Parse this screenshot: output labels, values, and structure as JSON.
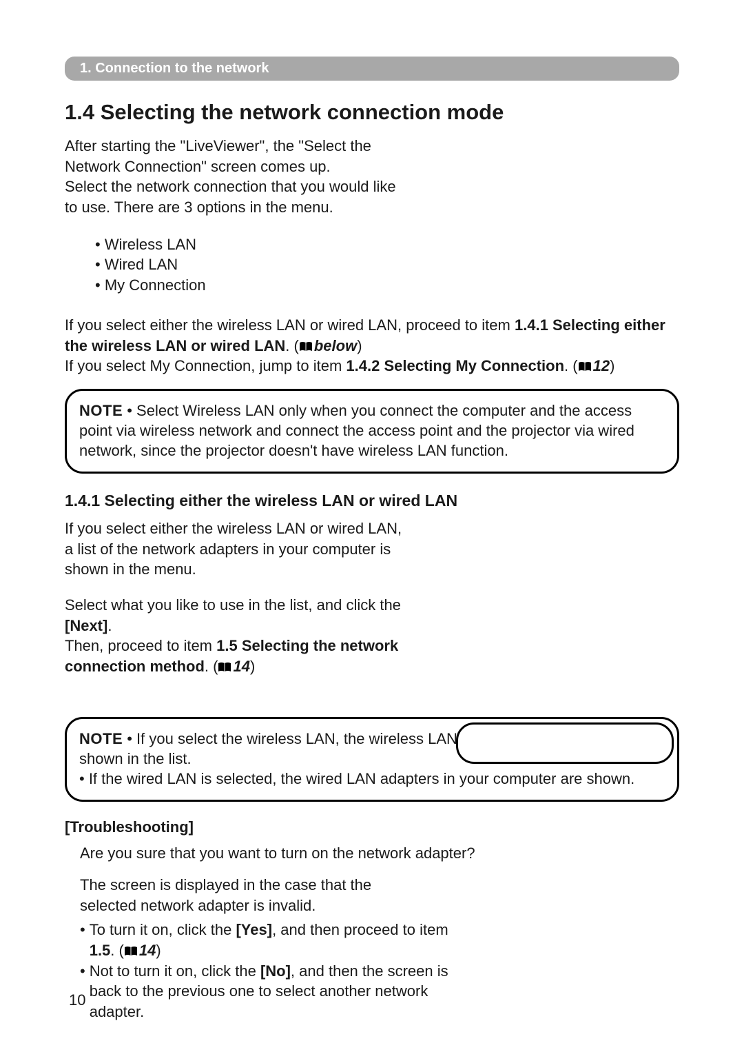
{
  "chapter_bar": "1. Connection to the network",
  "section_title": "1.4 Selecting the network connection mode",
  "intro_lines": [
    "After starting the \"LiveViewer\", the \"Select the",
    "Network Connection\" screen comes up.",
    "Select the network connection that you would like",
    "to use. There are 3 options in the menu."
  ],
  "options": [
    "Wireless LAN",
    "Wired LAN",
    "My Connection"
  ],
  "para1_pre": "If you select either the wireless LAN or wired LAN, proceed to item ",
  "para1_bold": "1.4.1 Selecting either the wireless LAN or wired LAN",
  "para1_post1": ". (",
  "para1_ref_text": "below",
  "para1_post2": ")",
  "para2_pre": "If you select My Connection, jump to item ",
  "para2_bold": "1.4.2 Selecting My Connection",
  "para2_post1": ". (",
  "para2_ref_text": "12",
  "para2_post2": ")",
  "note1_label": "NOTE",
  "note1_text": " • Select Wireless LAN only when you connect the computer and the access point via wireless network and connect the access point and the projector via wired network, since the projector doesn't have wireless LAN function.",
  "subsection_title": "1.4.1 Selecting either the wireless LAN or wired LAN",
  "sub_intro_lines": [
    "If you select either the wireless LAN or wired LAN,",
    "a list of the network adapters in your computer is",
    "shown in the menu."
  ],
  "sub_para_pre": "Select what you like to use in the list, and click the ",
  "sub_para_next": "[Next]",
  "sub_para_mid": ".\nThen, proceed to item ",
  "sub_para_bold": "1.5 Selecting the network connection method",
  "sub_para_post1": ". (",
  "sub_para_ref_text": "14",
  "sub_para_post2": ")",
  "note2_label": "NOTE",
  "note2_line1": " • If you select the wireless LAN, the wireless LAN adapters in your computer are shown in the list.",
  "note2_line2": "• If the wired LAN is selected, the wired LAN adapters in your computer are shown.",
  "trouble_heading": "[Troubleshooting]",
  "trouble_question": "Are you sure that you want to turn on the network adapter?",
  "trouble_body_lines": [
    "The screen is displayed in the case that the",
    "selected network adapter is invalid."
  ],
  "trouble_item1_pre": "To turn it on, click the ",
  "trouble_item1_yes": "[Yes]",
  "trouble_item1_mid": ", and then proceed to item ",
  "trouble_item1_bold": "1.5",
  "trouble_item1_post1": ". (",
  "trouble_item1_ref_text": "14",
  "trouble_item1_post2": ")",
  "trouble_item2_pre": "Not to turn it on, click the ",
  "trouble_item2_no": "[No]",
  "trouble_item2_post": ", and then the screen is back to the previous one to select another network adapter.",
  "page_number": "10"
}
